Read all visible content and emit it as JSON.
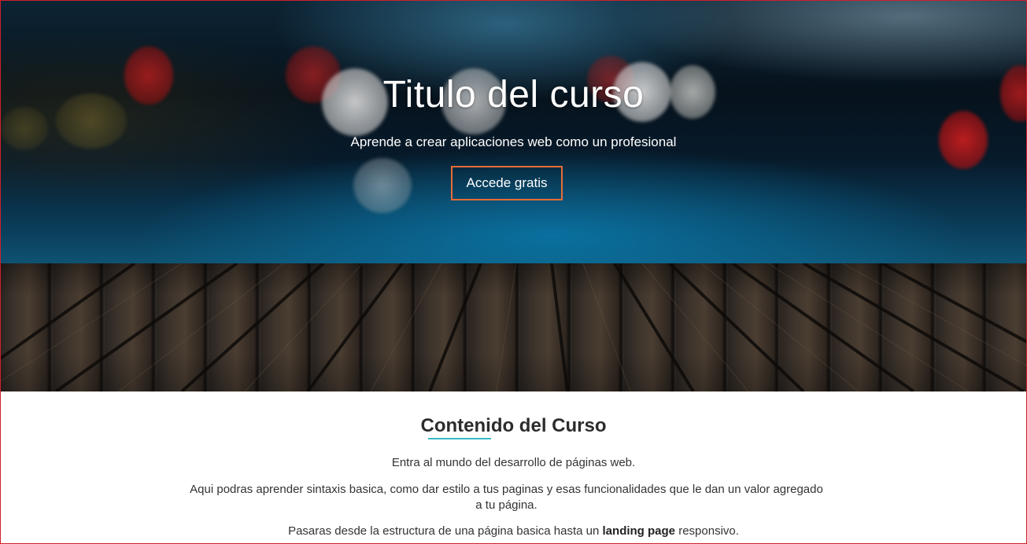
{
  "hero": {
    "title": "Titulo del curso",
    "subtitle": "Aprende a crear aplicaciones web como un profesional",
    "cta_label": "Accede gratis",
    "cta_border_color": "#e86c36"
  },
  "content": {
    "title": "Contenido del Curso",
    "underline_color": "#37b9c8",
    "paragraph_1": "Entra al mundo del desarrollo de páginas web.",
    "paragraph_2": "Aqui podras aprender sintaxis basica, como dar estilo a tus paginas y esas funcionalidades que le dan un valor agregado a tu página.",
    "paragraph_3_before": "Pasaras desde la estructura de una página basica hasta un ",
    "paragraph_3_bold": "landing page",
    "paragraph_3_after": " responsivo."
  },
  "frame_border_color": "#d0202a"
}
